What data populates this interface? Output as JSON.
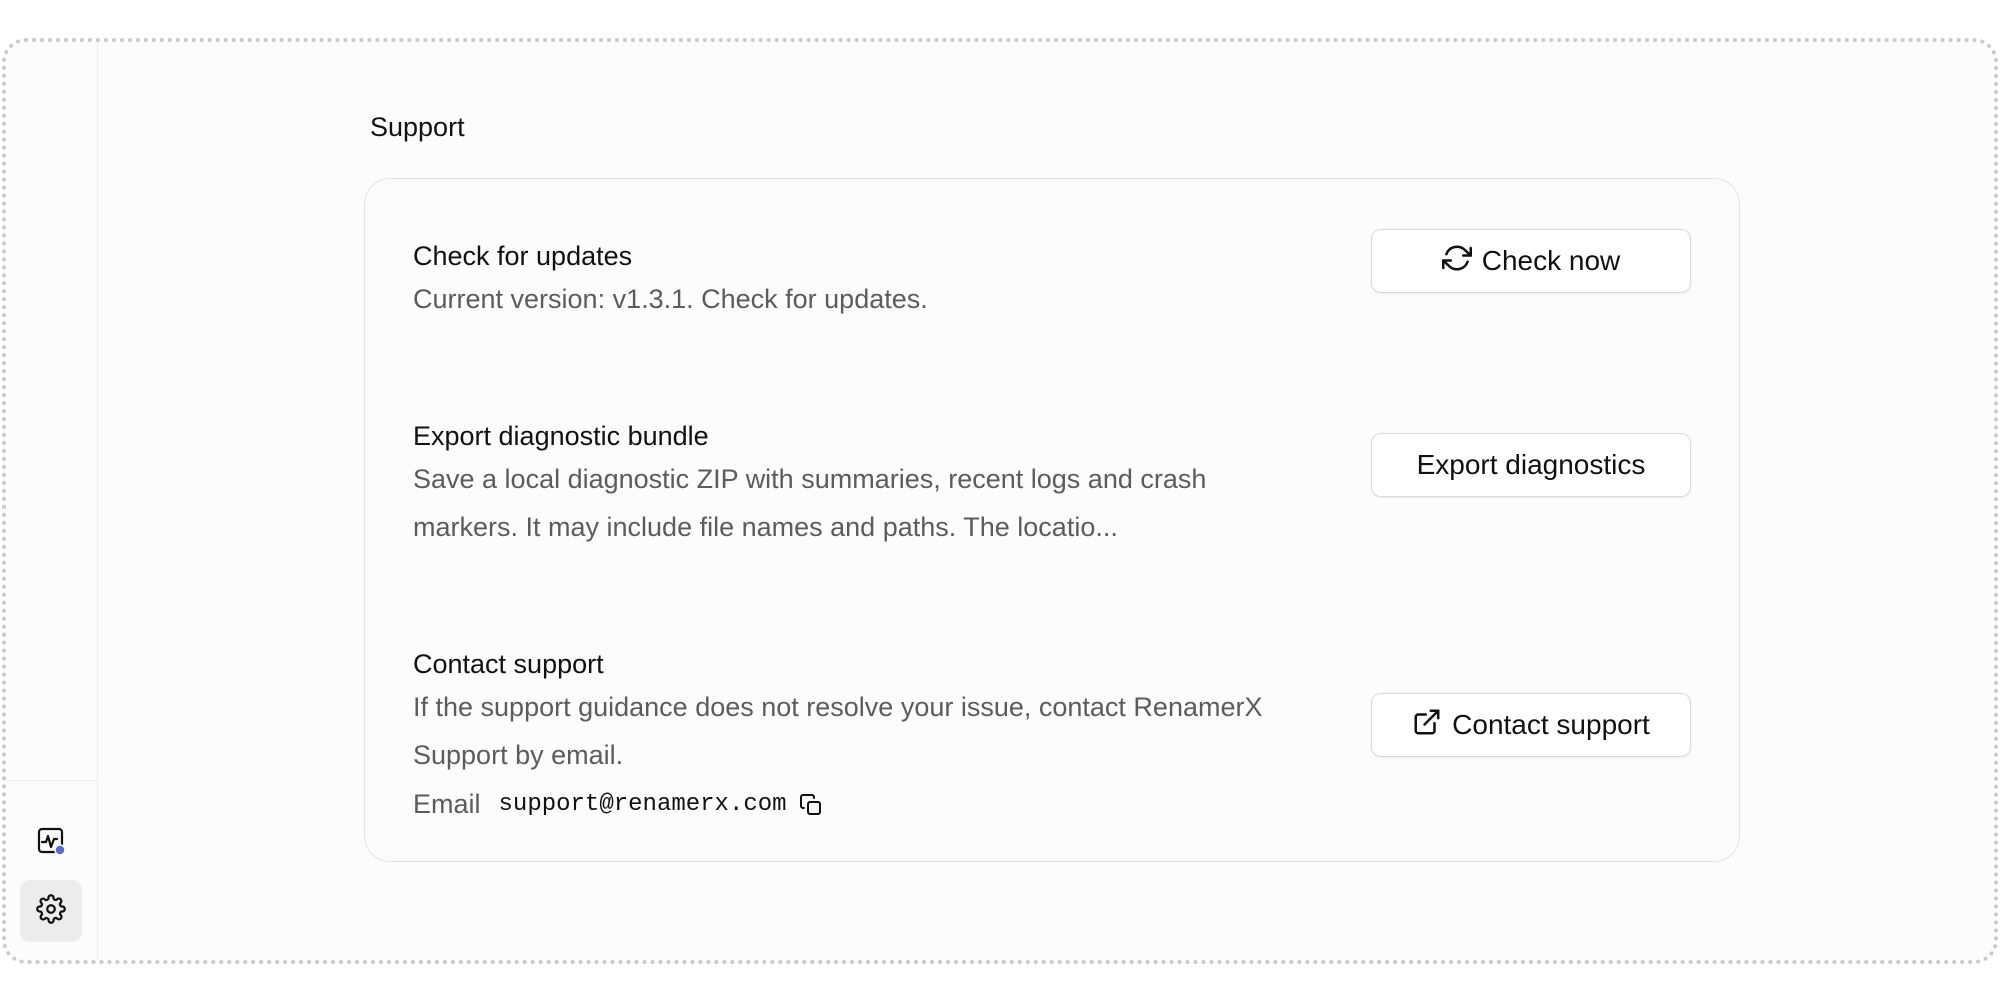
{
  "sidebar": {
    "items": [
      {
        "name": "activity",
        "icon": "activity-monitor-icon",
        "badge_color": "#5b6bd5"
      },
      {
        "name": "settings",
        "icon": "gear-icon",
        "active": true
      }
    ]
  },
  "section": {
    "title": "Support"
  },
  "updates": {
    "title": "Check for updates",
    "description": "Current version: v1.3.1. Check for updates.",
    "button_label": "Check now",
    "button_icon": "refresh-icon"
  },
  "diagnostics": {
    "title": "Export diagnostic bundle",
    "description": "Save a local diagnostic ZIP with summaries, recent logs and crash markers. It may include file names and paths. The locatio...",
    "button_label": "Export diagnostics"
  },
  "contact": {
    "title": "Contact support",
    "description": "If the support guidance does not resolve your issue, contact RenamerX Support by email.",
    "button_label": "Contact support",
    "button_icon": "external-link-icon",
    "email_label": "Email",
    "email_value": "support@renamerx.com",
    "copy_icon": "copy-icon"
  }
}
